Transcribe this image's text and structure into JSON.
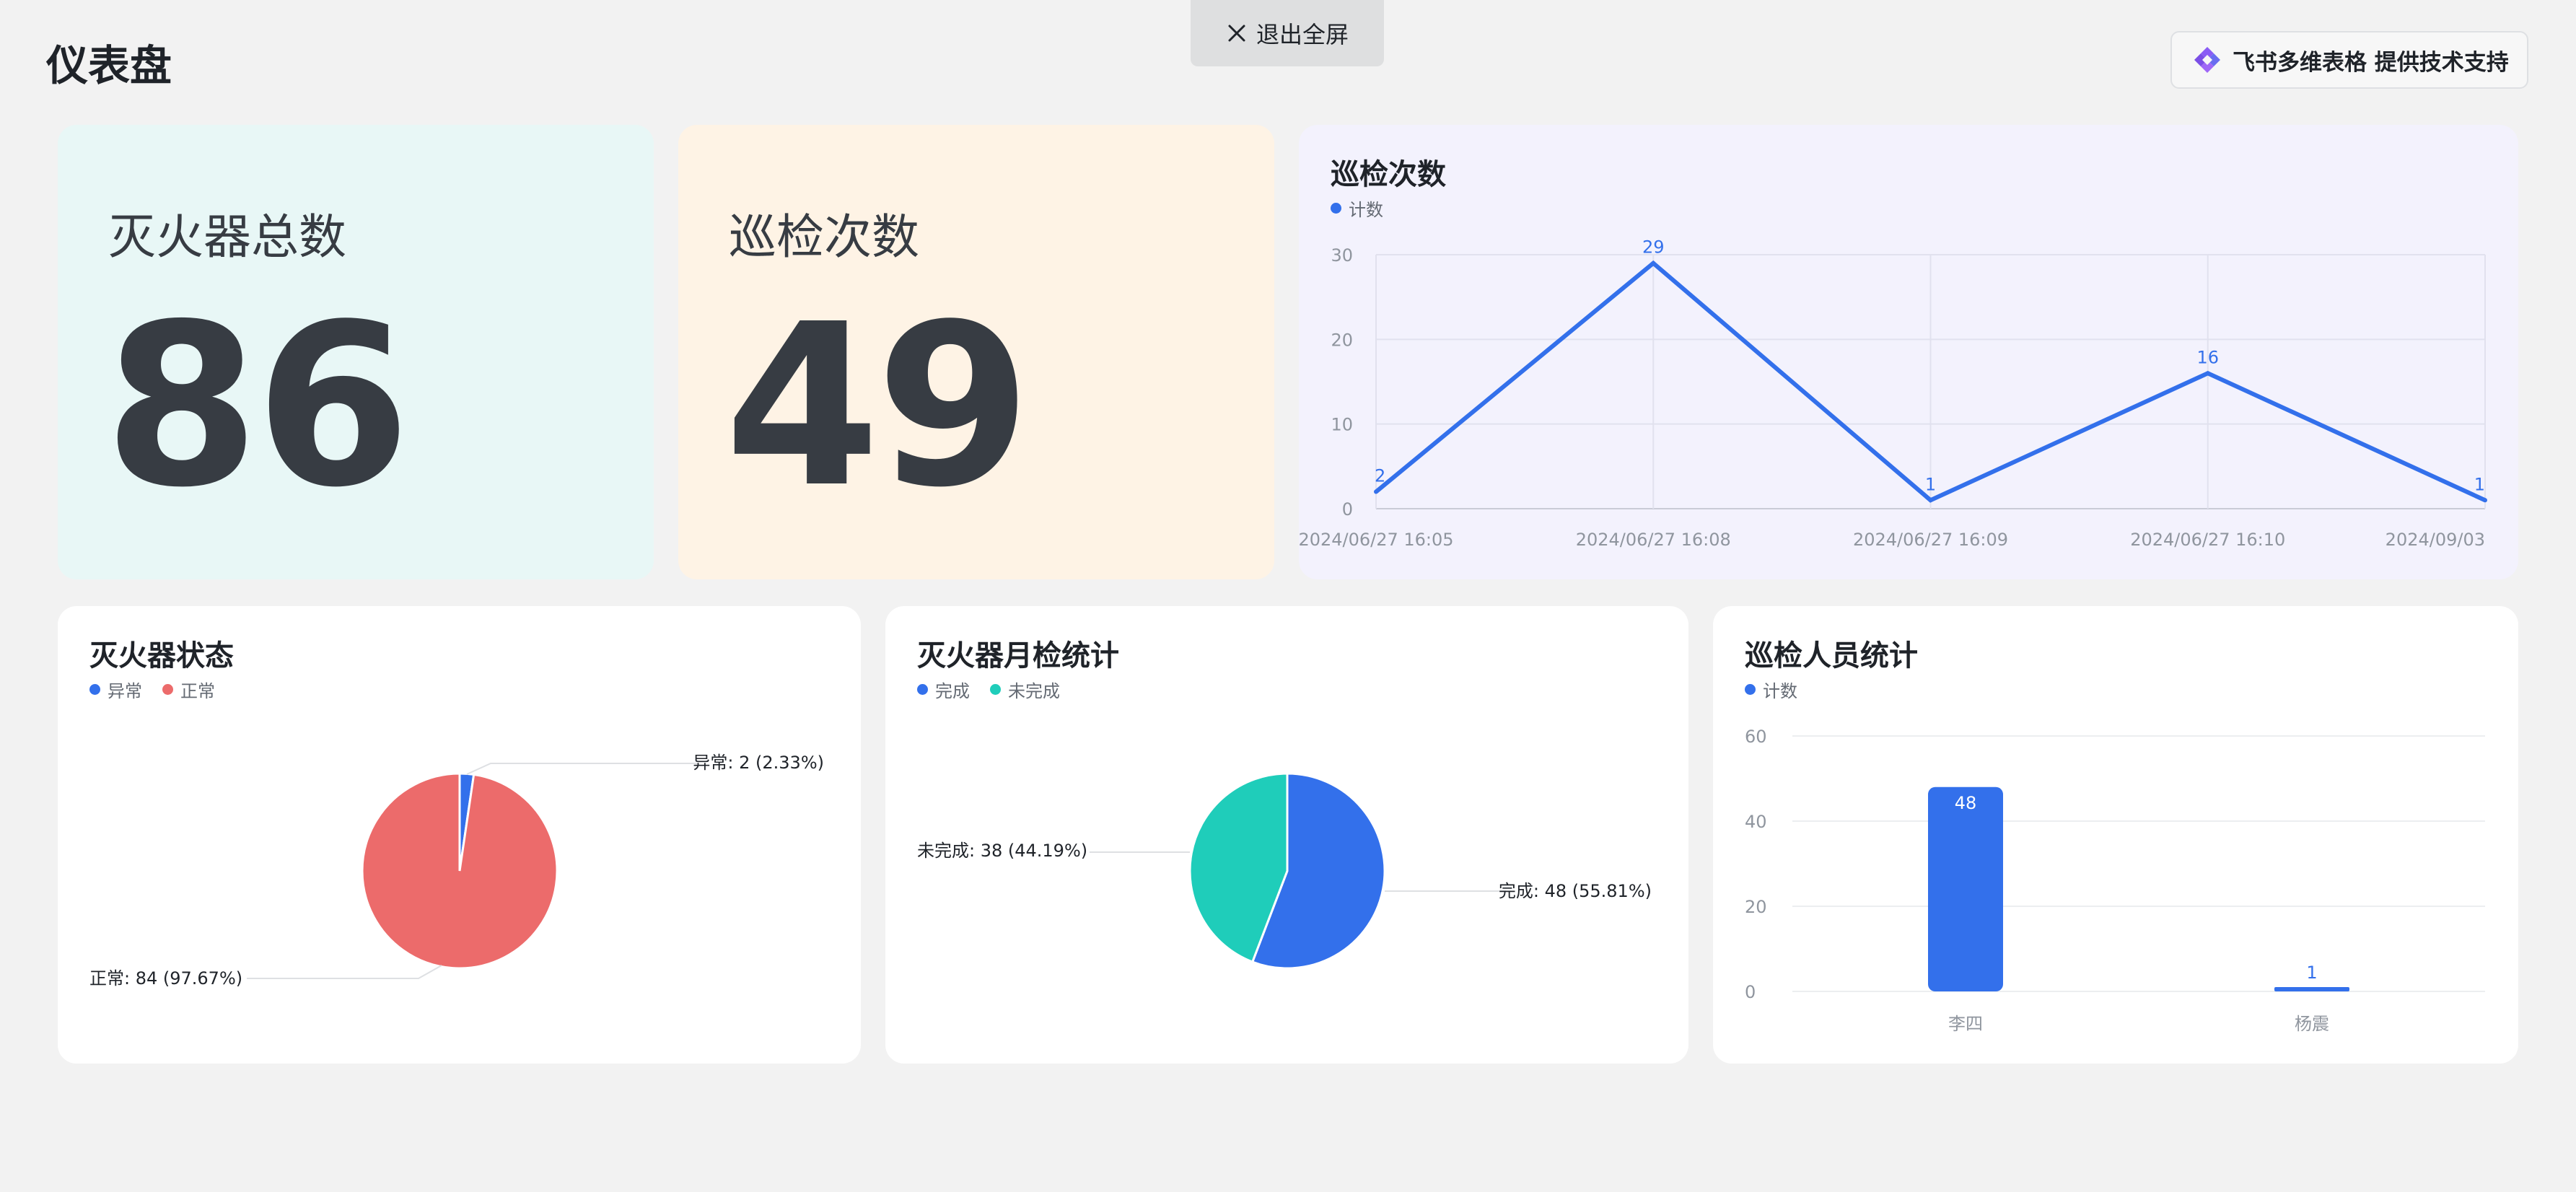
{
  "page": {
    "title": "仪表盘"
  },
  "exit": {
    "label": "退出全屏",
    "icon": "close-icon"
  },
  "brand": {
    "label": "飞书多维表格 提供技术支持",
    "icon": "feishu-bitable-logo"
  },
  "metrics": [
    {
      "label": "灭火器总数",
      "value": "86",
      "bg": "#e8f7f6"
    },
    {
      "label": "巡检次数",
      "value": "49",
      "bg": "#fef3e5"
    }
  ],
  "colors": {
    "blue": "#3370eb",
    "red": "#ec6b6b",
    "teal": "#1fcdba",
    "line_card_bg": "#f3f2fd"
  },
  "line_chart": {
    "title": "巡检次数",
    "legend": "计数"
  },
  "status_pie": {
    "title": "灭火器状态",
    "legend": [
      "异常",
      "正常"
    ],
    "label_abnormal": "异常: 2 (2.33%)",
    "label_normal": "正常: 84 (97.67%)"
  },
  "monthly_pie": {
    "title": "灭火器月检统计",
    "legend": [
      "完成",
      "未完成"
    ],
    "label_done": "完成: 48 (55.81%)",
    "label_undone": "未完成: 38 (44.19%)"
  },
  "bar_chart": {
    "title": "巡检人员统计",
    "legend": "计数"
  },
  "chart_data": [
    {
      "type": "line",
      "title": "巡检次数",
      "x": [
        "2024/06/27 16:05",
        "2024/06/27 16:08",
        "2024/06/27 16:09",
        "2024/06/27 16:10",
        "2024/09/03"
      ],
      "series": [
        {
          "name": "计数",
          "values": [
            2,
            29,
            1,
            16,
            1
          ]
        }
      ],
      "ylim": [
        0,
        30
      ],
      "yticks": [
        0,
        10,
        20,
        30
      ],
      "grid": true,
      "legend_position": "top-left"
    },
    {
      "type": "pie",
      "title": "灭火器状态",
      "labels": [
        "异常",
        "正常"
      ],
      "values": [
        2,
        84
      ],
      "percents": [
        2.33,
        97.67
      ],
      "colors": [
        "#3370eb",
        "#ec6b6b"
      ],
      "legend_position": "top-left"
    },
    {
      "type": "pie",
      "title": "灭火器月检统计",
      "labels": [
        "完成",
        "未完成"
      ],
      "values": [
        48,
        38
      ],
      "percents": [
        55.81,
        44.19
      ],
      "colors": [
        "#3370eb",
        "#1fcdba"
      ],
      "legend_position": "top-left"
    },
    {
      "type": "bar",
      "title": "巡检人员统计",
      "categories": [
        "李四",
        "杨震"
      ],
      "series": [
        {
          "name": "计数",
          "values": [
            48,
            1
          ]
        }
      ],
      "ylim": [
        0,
        60
      ],
      "yticks": [
        0,
        20,
        40,
        60
      ],
      "grid": true,
      "legend_position": "top-left"
    }
  ]
}
